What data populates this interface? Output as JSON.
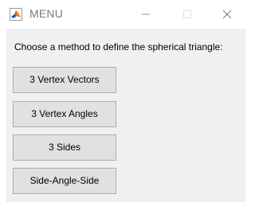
{
  "window": {
    "title": "MENU",
    "icons": {
      "app": "matlab-icon",
      "minimize": "minimize-icon",
      "maximize": "maximize-icon",
      "close": "close-icon"
    }
  },
  "dialog": {
    "prompt": "Choose a method to define the spherical triangle:",
    "buttons": [
      {
        "label": "3 Vertex Vectors"
      },
      {
        "label": "3 Vertex Angles"
      },
      {
        "label": "3 Sides"
      },
      {
        "label": "Side-Angle-Side"
      }
    ]
  },
  "colors": {
    "panel": "#f0f0f0",
    "button_face": "#e1e1e1",
    "button_border": "#adadad",
    "title_text": "#777777"
  }
}
